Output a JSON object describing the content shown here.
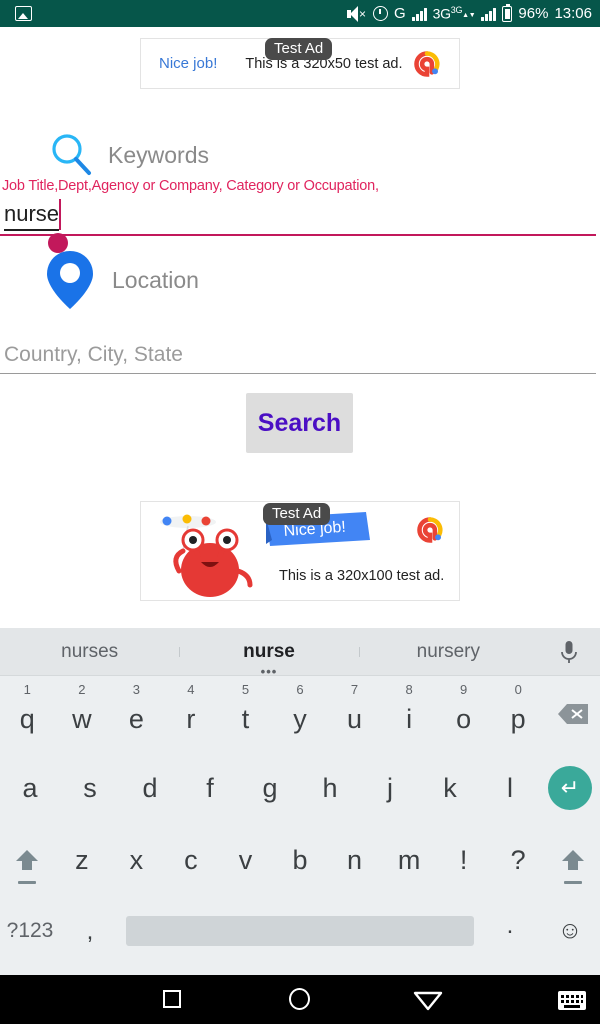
{
  "statusbar": {
    "image_icon": "image-icon",
    "mute_icon": "volume-mute-icon",
    "alarm_icon": "alarm-clock-icon",
    "gmail_letter": "G",
    "network_label": "3G",
    "network_sup": "3G",
    "battery_percent": "96%",
    "time": "13:06",
    "bg_color": "#06564a"
  },
  "ad_top": {
    "badge": "Test Ad",
    "cta": "Nice job!",
    "text": "This is a 320x50 test ad.",
    "logo": "admob-logo",
    "cta_color": "#3878d6"
  },
  "form": {
    "keywords": {
      "icon": "search-magnifier-icon",
      "label": "Keywords",
      "hint": "Job Title,Dept,Agency or Company, Category or Occupation,",
      "value": "nurse",
      "hint_color": "#e0245e",
      "underline_color": "#c2185b"
    },
    "location": {
      "icon": "map-pin-icon",
      "label": "Location",
      "placeholder": "Country, City, State",
      "value": ""
    },
    "search_button": {
      "label": "Search",
      "text_color": "#4b0fc4",
      "bg_color": "#dddddd"
    }
  },
  "ad_bottom": {
    "badge": "Test Ad",
    "ribbon_text": "Nice job!",
    "text": "This is a 320x100 test ad.",
    "logo": "admob-logo",
    "mascot": "red-monster-mascot"
  },
  "keyboard": {
    "suggestions": [
      {
        "word": "nurses",
        "selected": false
      },
      {
        "word": "nurse",
        "selected": true
      },
      {
        "word": "nursery",
        "selected": false
      }
    ],
    "selected_dots": "•••",
    "mic_icon": "microphone-icon",
    "row1": [
      {
        "num": "1",
        "ch": "q"
      },
      {
        "num": "2",
        "ch": "w"
      },
      {
        "num": "3",
        "ch": "e"
      },
      {
        "num": "4",
        "ch": "r"
      },
      {
        "num": "5",
        "ch": "t"
      },
      {
        "num": "6",
        "ch": "y"
      },
      {
        "num": "7",
        "ch": "u"
      },
      {
        "num": "8",
        "ch": "i"
      },
      {
        "num": "9",
        "ch": "o"
      },
      {
        "num": "0",
        "ch": "p"
      }
    ],
    "backspace_icon": "backspace-icon",
    "row2": [
      "a",
      "s",
      "d",
      "f",
      "g",
      "h",
      "j",
      "k",
      "l"
    ],
    "enter_icon": "enter-key-icon",
    "row3": [
      "z",
      "x",
      "c",
      "v",
      "b",
      "n",
      "m",
      "!",
      "?"
    ],
    "shift_icon": "shift-arrow-icon",
    "row4": {
      "symbols_key": "?123",
      "comma_key": ",",
      "space_key": "space-bar",
      "period_key": ".",
      "emoji_key": "☺"
    }
  },
  "navbar": {
    "recents": "recents-square-icon",
    "home": "home-circle-icon",
    "back": "back-triangle-icon",
    "keyboard_indicator": "keyboard-indicator-icon"
  }
}
